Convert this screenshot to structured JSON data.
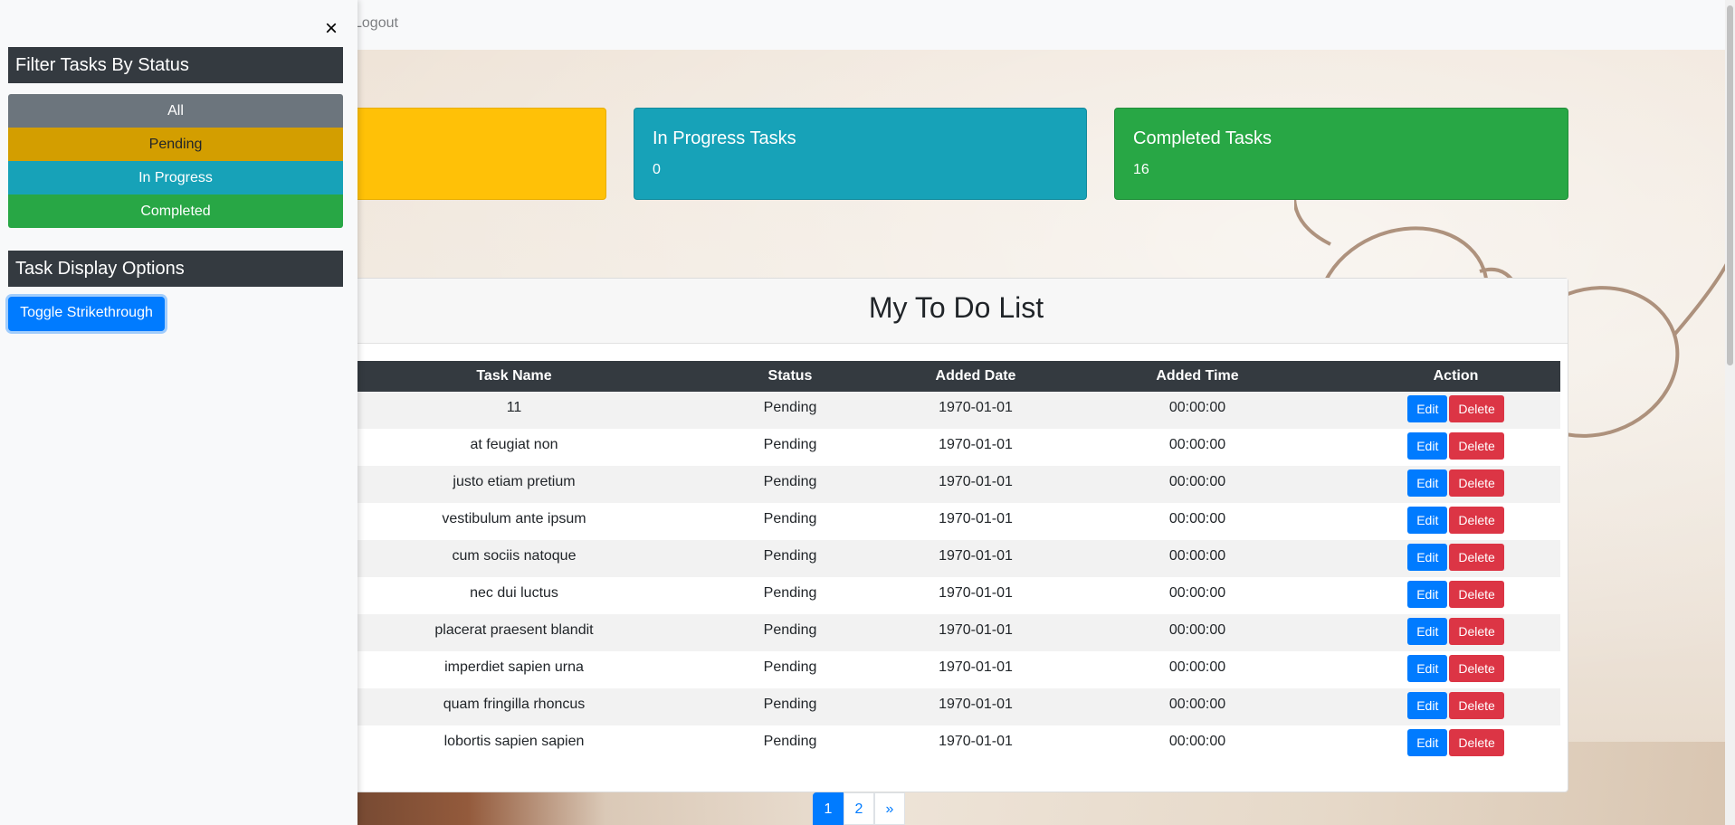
{
  "navbar": {
    "logout_label": "Logout"
  },
  "sidebar": {
    "close_label": "×",
    "filter_heading": "Filter Tasks By Status",
    "filters": [
      "All",
      "Pending",
      "In Progress",
      "Completed"
    ],
    "display_heading": "Task Display Options",
    "toggle_label": "Toggle Strikethrough"
  },
  "stats": {
    "in_progress": {
      "title": "In Progress Tasks",
      "count": "0"
    },
    "completed": {
      "title": "Completed Tasks",
      "count": "16"
    }
  },
  "todo": {
    "title": "My To Do List",
    "columns": [
      "Task Name",
      "Status",
      "Added Date",
      "Added Time",
      "Action"
    ],
    "rows": [
      {
        "name": "11",
        "status": "Pending",
        "date": "1970-01-01",
        "time": "00:00:00"
      },
      {
        "name": "at feugiat non",
        "status": "Pending",
        "date": "1970-01-01",
        "time": "00:00:00"
      },
      {
        "name": "justo etiam pretium",
        "status": "Pending",
        "date": "1970-01-01",
        "time": "00:00:00"
      },
      {
        "name": "vestibulum ante ipsum",
        "status": "Pending",
        "date": "1970-01-01",
        "time": "00:00:00"
      },
      {
        "name": "cum sociis natoque",
        "status": "Pending",
        "date": "1970-01-01",
        "time": "00:00:00"
      },
      {
        "name": "nec dui luctus",
        "status": "Pending",
        "date": "1970-01-01",
        "time": "00:00:00"
      },
      {
        "name": "placerat praesent blandit",
        "status": "Pending",
        "date": "1970-01-01",
        "time": "00:00:00"
      },
      {
        "name": "imperdiet sapien urna",
        "status": "Pending",
        "date": "1970-01-01",
        "time": "00:00:00"
      },
      {
        "name": "quam fringilla rhoncus",
        "status": "Pending",
        "date": "1970-01-01",
        "time": "00:00:00"
      },
      {
        "name": "lobortis sapien sapien",
        "status": "Pending",
        "date": "1970-01-01",
        "time": "00:00:00"
      }
    ],
    "edit_label": "Edit",
    "delete_label": "Delete"
  },
  "pagination": {
    "pages": [
      "1",
      "2"
    ],
    "next_label": "»",
    "active_page": "1"
  },
  "colors": {
    "primary": "#007bff",
    "danger": "#dc3545",
    "warning": "#ffc107",
    "info": "#17a2b8",
    "success": "#28a745",
    "dark": "#343a40",
    "secondary": "#6c757d"
  }
}
